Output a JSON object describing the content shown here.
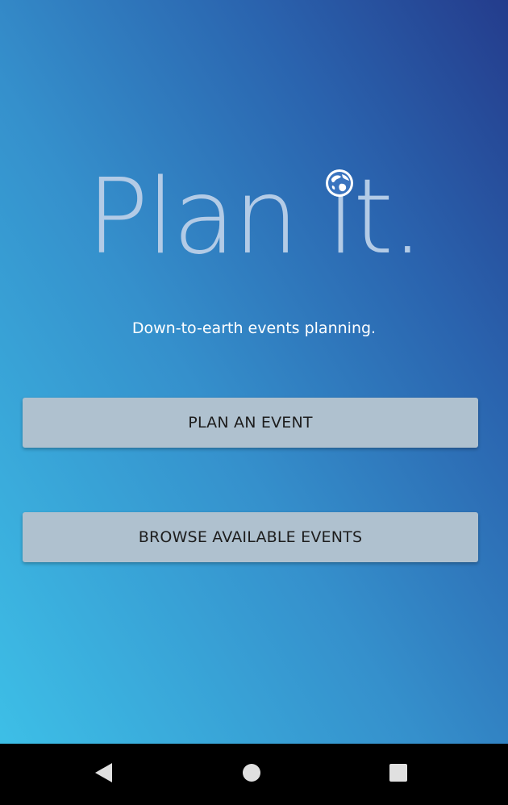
{
  "app": {
    "logo_text": "Plan it.",
    "tagline": "Down-to-earth events planning.",
    "globe_icon": "globe-icon"
  },
  "actions": {
    "plan_event_label": "PLAN AN EVENT",
    "browse_events_label": "BROWSE AVAILABLE EVENTS"
  },
  "navigation": {
    "back_icon": "back-triangle-icon",
    "home_icon": "home-circle-icon",
    "recents_icon": "recents-square-icon"
  },
  "colors": {
    "gradient_light": "#3ec3e9",
    "gradient_dark": "#243c8c",
    "logo": "#b3cbe6",
    "button": "#afc1cf",
    "button_text": "#1d1d1d",
    "navbar": "#000000"
  }
}
